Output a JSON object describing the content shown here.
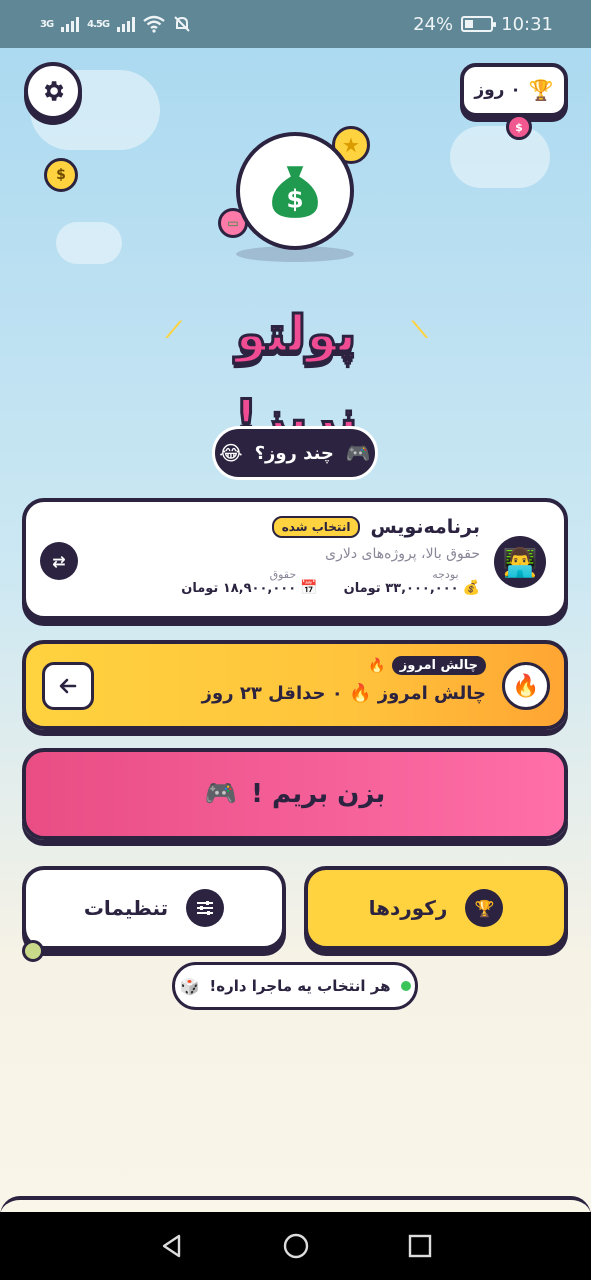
{
  "status_bar": {
    "network1": "3G",
    "network2": "4.5G",
    "battery": "24%",
    "time": "10:31"
  },
  "top": {
    "days_pill": "۰ روز",
    "trophy_icon": "trophy-icon",
    "settings_icon": "gear-icon"
  },
  "logo": {
    "text": "پولتو نریز!"
  },
  "days_question": {
    "label": "چند روز؟",
    "left_emoji": "😂",
    "right_emoji": "🎮"
  },
  "job_card": {
    "title": "برنامه‌نویس",
    "badge": "انتخاب شده",
    "subtitle": "حقوق بالا، پروژه‌های دلاری",
    "budget_label": "بودجه",
    "budget_value": "۳۳,۰۰۰,۰۰۰ تومان",
    "salary_label": "حقوق",
    "salary_value": "۱۸,۹۰۰,۰۰۰ تومان"
  },
  "challenge_card": {
    "badge": "چالش امروز",
    "text": "چالش امروز 🔥 ۰ حداقل ۲۳ روز"
  },
  "play_button": {
    "label": "بزن بریم !"
  },
  "actions": {
    "records": "رکوردها",
    "settings": "تنظیمات"
  },
  "footer_hint": {
    "text": "هر انتخاب یه ماجرا داره!"
  },
  "colors": {
    "dark": "#2b2340",
    "yellow": "#ffd23f",
    "pink": "#f0588f",
    "orange": "#ffb43a"
  }
}
